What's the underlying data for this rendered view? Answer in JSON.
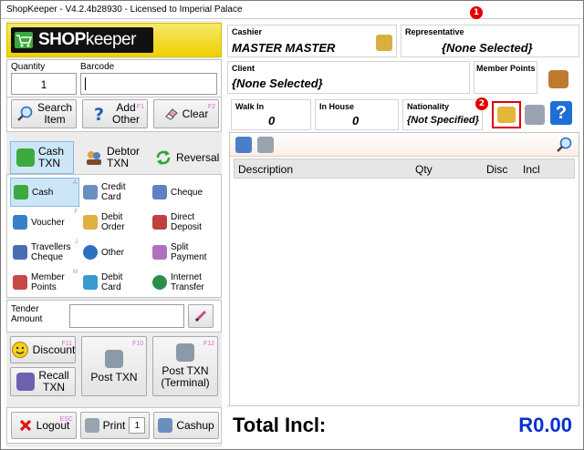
{
  "window": {
    "title": "ShopKeeper - V4.2.4b28930 - Licensed to Imperial Palace"
  },
  "callouts": [
    "1",
    "2"
  ],
  "logo": {
    "shop": "SHOP",
    "keeper": "keeper"
  },
  "entry": {
    "quantity_label": "Quantity",
    "quantity_value": "1",
    "barcode_label": "Barcode",
    "barcode_value": ""
  },
  "actions": {
    "search_line1": "Search",
    "search_line2": "Item",
    "add_line1": "Add",
    "add_line2": "Other",
    "add_key": "F1",
    "clear": "Clear",
    "clear_key": "F2"
  },
  "txn_tabs": [
    {
      "line1": "Cash",
      "line2": "TXN"
    },
    {
      "line1": "Debtor",
      "line2": "TXN"
    },
    {
      "line1": "Reversal",
      "line2": ""
    }
  ],
  "payments": [
    {
      "line1": "Cash",
      "line2": "",
      "key": "A"
    },
    {
      "line1": "Credit",
      "line2": "Card",
      "key": ""
    },
    {
      "line1": "Cheque",
      "line2": "",
      "key": ""
    },
    {
      "line1": "Voucher",
      "line2": "",
      "key": "F"
    },
    {
      "line1": "Debit",
      "line2": "Order",
      "key": ""
    },
    {
      "line1": "Direct",
      "line2": "Deposit",
      "key": ""
    },
    {
      "line1": "Travellers",
      "line2": "Cheque",
      "key": "J"
    },
    {
      "line1": "Other",
      "line2": "",
      "key": ""
    },
    {
      "line1": "Split",
      "line2": "Payment",
      "key": ""
    },
    {
      "line1": "Member",
      "line2": "Points",
      "key": "M"
    },
    {
      "line1": "Debit",
      "line2": "Card",
      "key": ""
    },
    {
      "line1": "Internet",
      "line2": "Transfer",
      "key": ""
    }
  ],
  "tender": {
    "label_line1": "Tender",
    "label_line2": "Amount",
    "value": ""
  },
  "bottom_actions": {
    "discount": "Discount",
    "discount_key": "F11",
    "recall_line1": "Recall",
    "recall_line2": "TXN",
    "post_txn": "Post TXN",
    "post_key": "F10",
    "post_terminal_line1": "Post TXN",
    "post_terminal_line2": "(Terminal)",
    "post_terminal_key": "F12"
  },
  "footer": {
    "logout": "Logout",
    "logout_key": "ESC",
    "print": "Print",
    "print_copies": "1",
    "cashup": "Cashup"
  },
  "info": {
    "cashier_label": "Cashier",
    "cashier_value": "MASTER MASTER",
    "rep_label": "Representative",
    "rep_value": "{None Selected}",
    "client_label": "Client",
    "client_value": "{None Selected}",
    "member_points_label": "Member Points",
    "member_points_value": "",
    "walkin_label": "Walk In",
    "walkin_value": "0",
    "inhouse_label": "In House",
    "inhouse_value": "0",
    "nationality_label": "Nationality",
    "nationality_value": "{Not Specified}"
  },
  "grid": {
    "columns": [
      "Description",
      "Qty",
      "Disc",
      "Incl"
    ]
  },
  "totals": {
    "label": "Total Incl:",
    "value": "R0.00"
  },
  "colors": {
    "accent_blue": "#0a2fd0",
    "callout_red": "#e00000",
    "active_tab": "#cde6f7"
  },
  "icons": [
    "cart-icon",
    "magnifier-icon",
    "question-icon",
    "eraser-icon",
    "cash-icon",
    "debtor-icon",
    "reversal-icon",
    "voucher-icon",
    "card-icon",
    "cheque-icon",
    "globe-icon",
    "smiley-icon",
    "register-icon",
    "printer-icon",
    "close-icon",
    "help-icon",
    "keyboard-icon"
  ]
}
